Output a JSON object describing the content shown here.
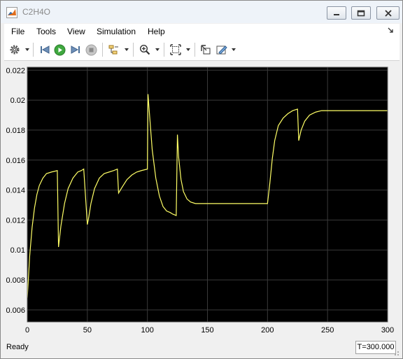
{
  "window": {
    "title": "C2H4O"
  },
  "menu": [
    {
      "label": "File"
    },
    {
      "label": "Tools"
    },
    {
      "label": "View"
    },
    {
      "label": "Simulation"
    },
    {
      "label": "Help"
    }
  ],
  "toolbar": {
    "icons": [
      "gear-icon",
      "step-back-icon",
      "run-icon",
      "step-forward-icon",
      "stop-icon",
      "highlight-icon",
      "zoom-in-icon",
      "fit-icon",
      "restore-icon",
      "style-icon"
    ]
  },
  "colors": {
    "plot_bg": "#000000",
    "axes_bg": "#f0f0f0",
    "grid": "#3a3a3a",
    "trace": "#ffff66",
    "tick_text": "#000000"
  },
  "chart_data": {
    "type": "line",
    "title": "",
    "xlabel": "",
    "ylabel": "",
    "xlim": [
      0,
      300
    ],
    "ylim": [
      0.0052,
      0.0222
    ],
    "xticks": [
      0,
      50,
      100,
      150,
      200,
      250,
      300
    ],
    "xtick_labels": [
      "0",
      "50",
      "100",
      "150",
      "200",
      "250",
      "300"
    ],
    "yticks": [
      0.006,
      0.008,
      0.01,
      0.012,
      0.014,
      0.016,
      0.018,
      0.02,
      0.022
    ],
    "ytick_labels": [
      "0.006",
      "0.008",
      "0.01",
      "0.012",
      "0.014",
      "0.016",
      "0.018",
      "0.02",
      "0.022"
    ],
    "grid": true,
    "series": [
      {
        "x": [
          0,
          2,
          4,
          6,
          8,
          10,
          13,
          16,
          20,
          25,
          26,
          28,
          31,
          34,
          38,
          42,
          45,
          47,
          50,
          51,
          53,
          56,
          60,
          64,
          68,
          72,
          75,
          76,
          79,
          83,
          87,
          91,
          95,
          100,
          100.5,
          102,
          104,
          107,
          110,
          113,
          116,
          119,
          121,
          124,
          125,
          126,
          128,
          130,
          133,
          136,
          140,
          145,
          150,
          160,
          180,
          200,
          202,
          204,
          206,
          209,
          213,
          217,
          221,
          225,
          226,
          228,
          231,
          235,
          240,
          245,
          250,
          260,
          280,
          300
        ],
        "y": [
          0.0068,
          0.0096,
          0.0115,
          0.0128,
          0.0137,
          0.0143,
          0.0148,
          0.0151,
          0.0152,
          0.0153,
          0.0102,
          0.0116,
          0.0131,
          0.0141,
          0.0148,
          0.0152,
          0.0153,
          0.0154,
          0.0117,
          0.0121,
          0.0131,
          0.0141,
          0.0148,
          0.0151,
          0.0152,
          0.0153,
          0.0154,
          0.0138,
          0.0142,
          0.0147,
          0.015,
          0.0152,
          0.0153,
          0.0154,
          0.0204,
          0.0188,
          0.0167,
          0.0148,
          0.0136,
          0.0129,
          0.0126,
          0.0125,
          0.0124,
          0.0123,
          0.0177,
          0.0162,
          0.0147,
          0.0139,
          0.0134,
          0.0132,
          0.0131,
          0.0131,
          0.0131,
          0.0131,
          0.0131,
          0.0131,
          0.0145,
          0.0161,
          0.0173,
          0.0183,
          0.0188,
          0.0191,
          0.0193,
          0.0194,
          0.0173,
          0.018,
          0.0186,
          0.019,
          0.0192,
          0.0193,
          0.0193,
          0.0193,
          0.0193,
          0.0193
        ]
      }
    ]
  },
  "status": {
    "ready": "Ready",
    "time": "T=300.000"
  }
}
